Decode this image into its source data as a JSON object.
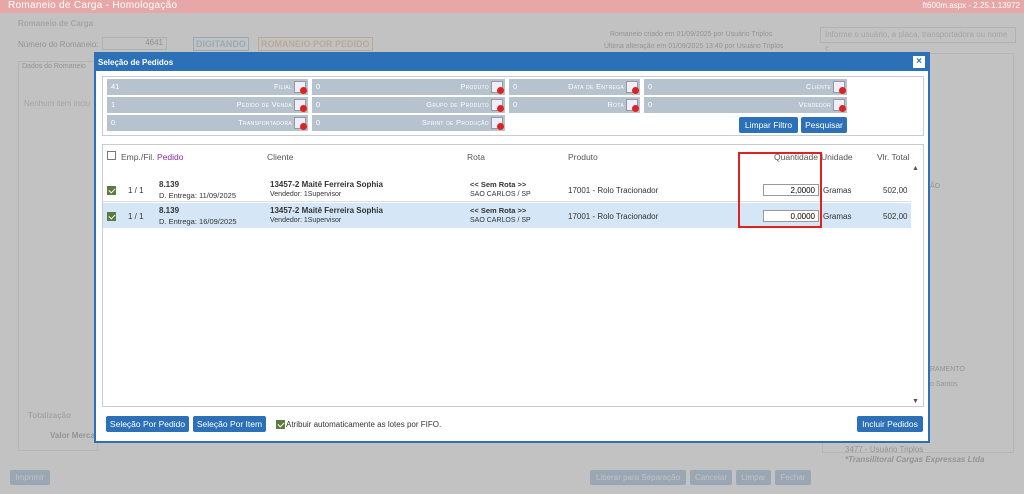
{
  "app": {
    "title": "Romaneio de Carga - Homologação",
    "version": "ft600m.aspx - 2.25.1.13972"
  },
  "background": {
    "section_title": "Romaneio de Carga",
    "numero_label": "Número do Romaneio:",
    "numero_value": "4641",
    "status_digitando": "DIGITANDO",
    "status_pedido": "ROMANEIO POR PEDIDO",
    "criado_info": "Romaneio criado em 01/09/2025 por Usuário Triplos",
    "alterado_info": "Última alteração em 01/09/2025 13:40 por Usuário Triplos",
    "search_placeholder": "Informe o usuário, a placa, transportadora ou nome c",
    "dados_tab": "Dados do Romaneio",
    "empty_msg": "Nenhum item inclu",
    "totalizacao": "Totalização",
    "valor_merc": "Valor Merca",
    "ramento": "RAMENTO",
    "santos": "o Santos",
    "ao": "ÃO",
    "usuario_triplos": "3477 - Usuário Triplos",
    "transp": "*Transilitoral Cargas Expressas Ltda",
    "btn_imprimir": "Imprimir",
    "btn_liberar": "Liberar para Separação",
    "btn_cancelar": "Cancelar",
    "btn_limpar": "Limpar",
    "btn_fechar": "Fechar"
  },
  "modal": {
    "title": "Seleção de Pedidos",
    "filters": [
      {
        "value": "41",
        "label": "Filial"
      },
      {
        "value": "0",
        "label": "Produto"
      },
      {
        "value": "0",
        "label": "Data de Entrega"
      },
      {
        "value": "0",
        "label": "Cliente"
      },
      {
        "value": "1",
        "label": "Pedido de Venda"
      },
      {
        "value": "0",
        "label": "Grupo de Produto"
      },
      {
        "value": "0",
        "label": "Rota"
      },
      {
        "value": "0",
        "label": "Vendedor"
      },
      {
        "value": "0",
        "label": "Transportadora"
      },
      {
        "value": "0",
        "label": "Sprint de Produção"
      }
    ],
    "btn_limpar_filtro": "Limpar Filtro",
    "btn_pesquisar": "Pesquisar",
    "columns": {
      "emp": "Emp./Fil.",
      "pedido": "Pedido",
      "cliente": "Cliente",
      "rota": "Rota",
      "produto": "Produto",
      "quantidade": "Quantidade",
      "unidade": "Unidade",
      "vlr_total": "Vlr. Total"
    },
    "rows": [
      {
        "checked": true,
        "emp": "1 / 1",
        "pedido": "8.139",
        "entrega": "D. Entrega: 11/09/2025",
        "cliente": "13457-2 Maitê Ferreira Sophia",
        "vendedor": "Vendedor: 1Supervisor",
        "rota": "<< Sem Rota >>",
        "cidade": "SAO CARLOS / SP",
        "produto": "17001 - Rolo Tracionador",
        "quantidade": "2,0000",
        "unidade": "Gramas",
        "vlr_total": "502,00"
      },
      {
        "checked": true,
        "emp": "1 / 1",
        "pedido": "8.139",
        "entrega": "D. Entrega: 16/09/2025",
        "cliente": "13457-2 Maitê Ferreira Sophia",
        "vendedor": "Vendedor: 1Supervisor",
        "rota": "<< Sem Rota >>",
        "cidade": "SAO CARLOS / SP",
        "produto": "17001 - Rolo Tracionador",
        "quantidade": "0,0000",
        "unidade": "Gramas",
        "vlr_total": "502,00"
      }
    ],
    "btn_sel_pedido": "Seleção Por Pedido",
    "btn_sel_item": "Seleção Por Item",
    "fifo_label": "Atribuir automaticamente as lotes por FIFO.",
    "btn_incluir": "Incluir Pedidos"
  }
}
